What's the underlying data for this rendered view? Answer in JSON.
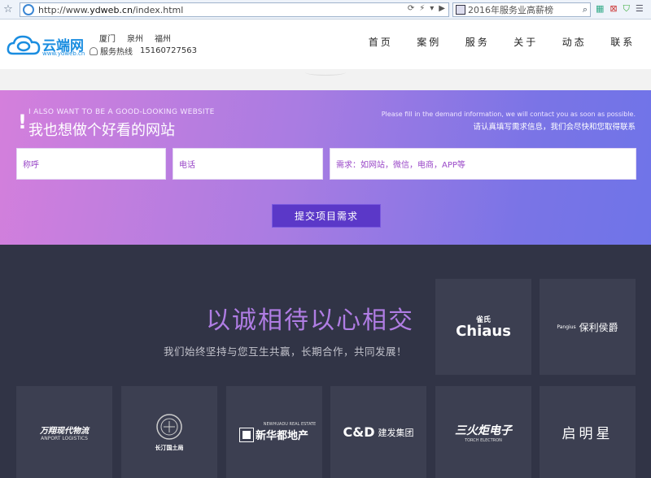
{
  "browser": {
    "url_prefix": "http://www.",
    "url_domain": "ydweb.cn",
    "url_suffix": "/index.html",
    "search_text": "2016年服务业高薪榜"
  },
  "header": {
    "logo_text": "云端网",
    "logo_sub": "www.ydweb.cn",
    "cities": [
      "厦门",
      "泉州",
      "福州"
    ],
    "hotline_label": "服务热线",
    "hotline_number": "15160727563",
    "nav": [
      "首页",
      "案例",
      "服务",
      "关于",
      "动态",
      "联系"
    ]
  },
  "demand": {
    "en_title": "I ALSO WANT TO BE A GOOD-LOOKING WEBSITE",
    "cn_title": "我也想做个好看的网站",
    "notice_en": "Please fill in the demand information, we will contact you as soon as possible.",
    "notice_cn": "请认真填写需求信息，我们会尽快和您取得联系",
    "name_placeholder": "称呼",
    "phone_placeholder": "电话",
    "need_placeholder": "需求：如网站，微信，电商，APP等",
    "submit_label": "提交项目需求"
  },
  "partners": {
    "slogan": "以诚相待以心相交",
    "subtitle": "我们始终坚持与您互生共赢，长期合作，共同发展！",
    "clients": [
      {
        "main": "雀氏",
        "second": "Chiaus"
      },
      {
        "main": "Pangius",
        "second": "保利侯爵"
      },
      {
        "main": "万翔现代物流",
        "second": "ANPORT LOGISTICS"
      },
      {
        "main": "长汀国土局",
        "second": ""
      },
      {
        "main": "NEWHUADU REAL ESTATE",
        "second": "新华都地产"
      },
      {
        "main": "C&D",
        "second": "建发集团"
      },
      {
        "main": "三火炬电子",
        "second": "TORCH ELECTRON"
      },
      {
        "main": "启明星",
        "second": ""
      }
    ]
  },
  "colors": {
    "accent": "#1a8de0",
    "banner_start": "#d47fdc",
    "banner_end": "#6f74e8",
    "button": "#5b38c8",
    "dark_bg": "#313446",
    "tile_bg": "#3c3f51",
    "slogan": "#b07de4"
  }
}
